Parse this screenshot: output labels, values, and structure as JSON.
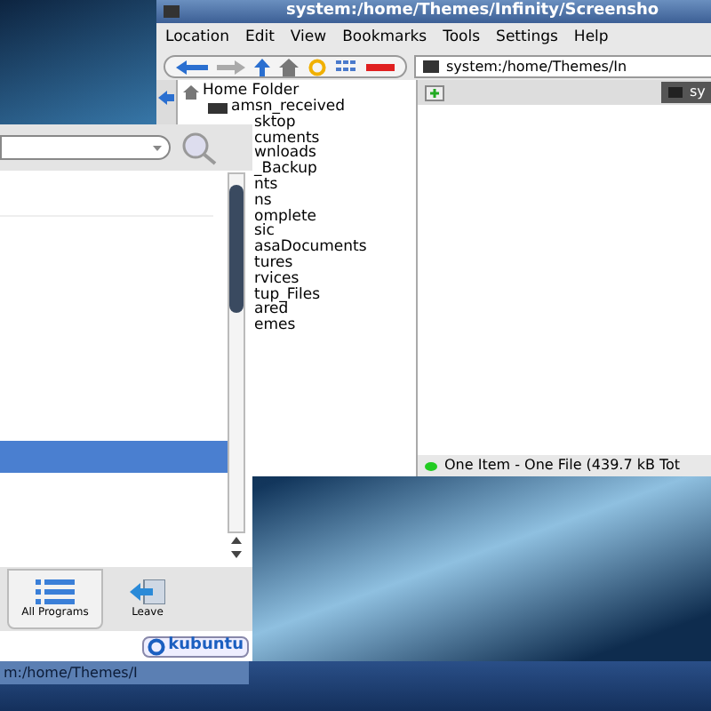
{
  "konqueror": {
    "title": "system:/home/Themes/Infinity/Screensho",
    "menu": [
      "Location",
      "Edit",
      "View",
      "Bookmarks",
      "Tools",
      "Settings",
      "Help"
    ],
    "location": "system:/home/Themes/In",
    "tab": "sy",
    "tree": [
      {
        "label": "Home Folder",
        "children": [
          {
            "label": "amsn_received"
          },
          {
            "label": "sktop"
          },
          {
            "label": "cuments"
          },
          {
            "label": "wnloads"
          },
          {
            "label": "_Backup"
          },
          {
            "label": "nts"
          },
          {
            "label": "ns"
          },
          {
            "label": "omplete"
          },
          {
            "label": "sic"
          },
          {
            "label": "asaDocuments"
          },
          {
            "label": "tures"
          },
          {
            "label": "rvices"
          },
          {
            "label": "tup_Files"
          },
          {
            "label": "ared"
          },
          {
            "label": "emes"
          }
        ]
      }
    ],
    "status": "One Item - One File (439.7 kB Tot"
  },
  "kickoff": {
    "highlighted_row": true,
    "tabs": [
      {
        "label": "All Programs",
        "selected": true,
        "kind": "list"
      },
      {
        "label": "Leave",
        "selected": false,
        "kind": "leave"
      }
    ],
    "brand": "kubuntu"
  },
  "taskbar": {
    "task": "m:/home/Themes/I"
  }
}
